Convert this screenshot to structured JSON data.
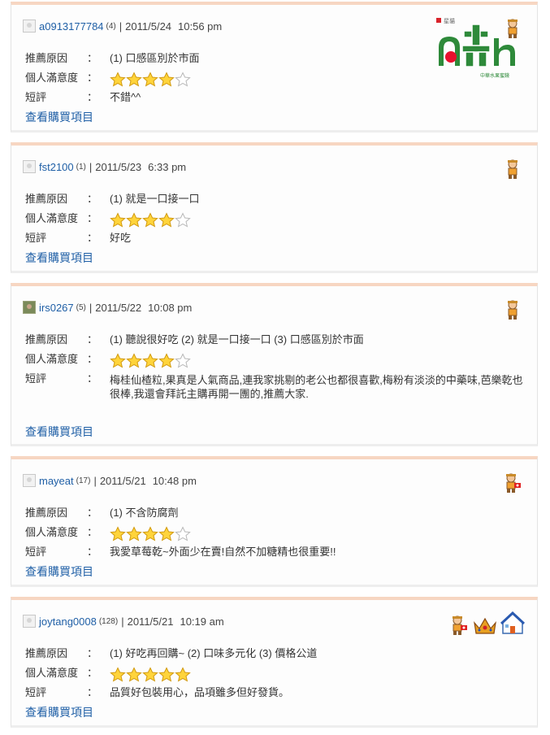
{
  "labels": {
    "reason": "推薦原因",
    "satisfaction": "個人滿意度",
    "comment": "短評",
    "colon": "：",
    "view_items": "查看購買項目",
    "separator": "|"
  },
  "colors": {
    "link": "#1f5fa6",
    "card_top_border": "#f7d6c2",
    "star_fill": "#ffd43b",
    "star_empty": "#ffffff",
    "logo_green": "#2e8a3a"
  },
  "logo": {
    "brand_text": "中華水果蜜餞",
    "top_text": "星貓"
  },
  "reviews": [
    {
      "username": "a0913177784",
      "count": "(4)",
      "date": "2011/5/24",
      "time": "10:56 pm",
      "reason": "(1) 口感區別於市面",
      "rating": 4,
      "comment": "不錯^^",
      "badges": [
        "person-icon"
      ]
    },
    {
      "username": "fst2100",
      "count": "(1)",
      "date": "2011/5/23",
      "time": "6:33 pm",
      "reason": "(1) 就是一口接一口",
      "rating": 4,
      "comment": "好吃",
      "badges": [
        "person-icon"
      ]
    },
    {
      "username": "irs0267",
      "count": "(5)",
      "date": "2011/5/22",
      "time": "10:08 pm",
      "reason": "(1) 聽說很好吃   (2) 就是一口接一口   (3) 口感區別於市面",
      "rating": 4,
      "comment": "梅桂仙楂粒,果真是人氣商品,連我家挑剔的老公也都很喜歡,梅粉有淡淡的中藥味,芭樂乾也很棒,我還會拜託主購再開一團的,推薦大家.",
      "badges": [
        "person-icon"
      ]
    },
    {
      "username": "mayeat",
      "count": "(17)",
      "date": "2011/5/21",
      "time": "10:48 pm",
      "reason": "(1) 不含防腐劑",
      "rating": 4,
      "comment": "我愛草莓乾~外面少在賣!自然不加糖精也很重要!!",
      "badges": [
        "person-flag-icon"
      ]
    },
    {
      "username": "joytang0008",
      "count": "(128)",
      "date": "2011/5/21",
      "time": "10:19 am",
      "reason": "(1) 好吃再回購~   (2) 口味多元化   (3) 價格公道",
      "rating": 5,
      "comment": "品質好包裝用心，品項雖多但好發貨。",
      "badges": [
        "person-flag-icon",
        "crown-icon",
        "house-icon"
      ]
    }
  ]
}
